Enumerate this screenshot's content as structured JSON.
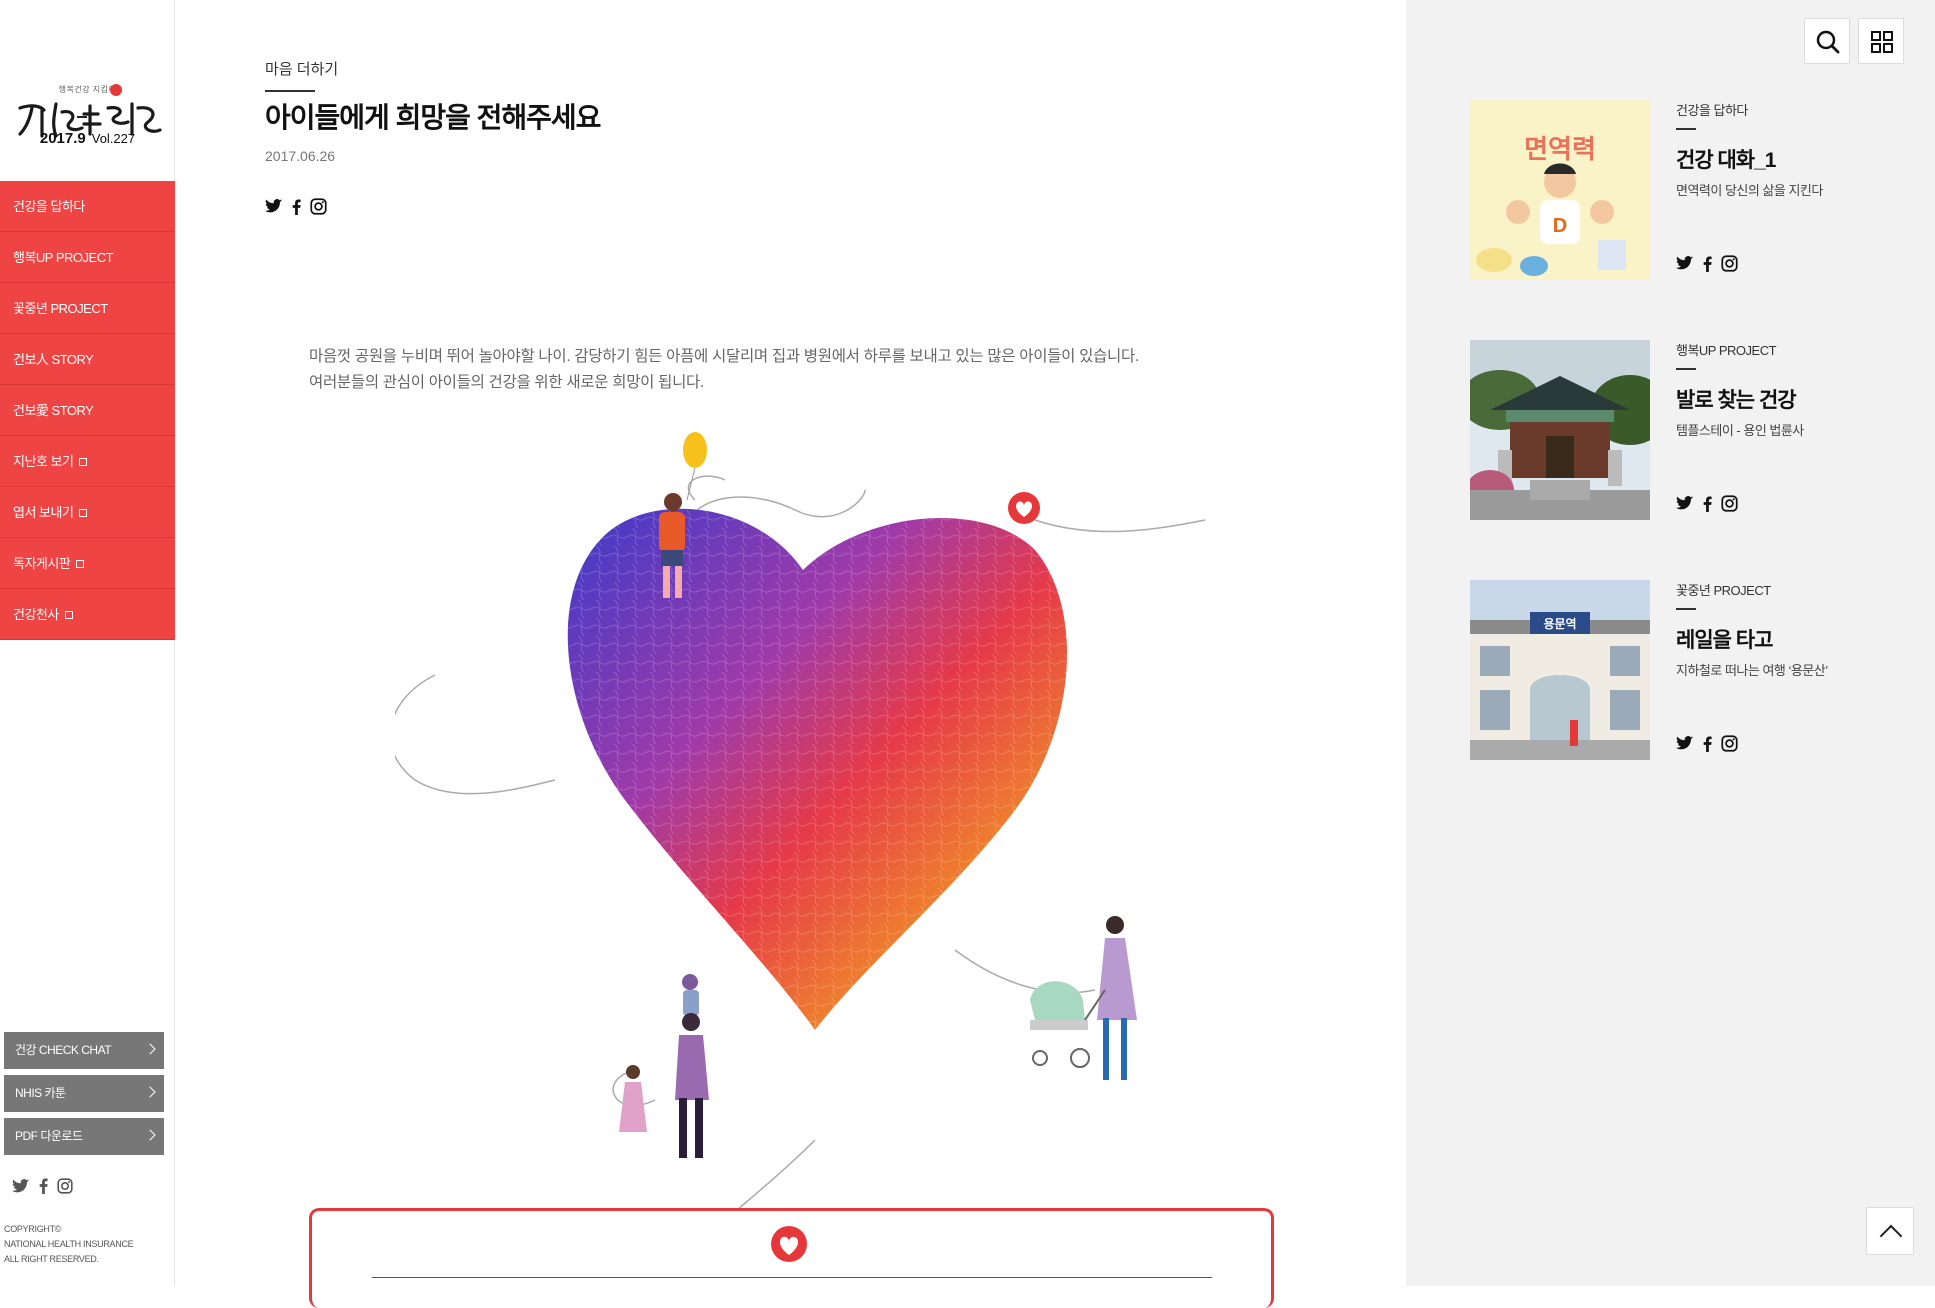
{
  "brand": {
    "tagline": "행복건강 지킴이",
    "logo_text": "건강보험",
    "issue_date": "2017.9",
    "issue_vol": "Vol.227"
  },
  "menu": [
    {
      "label": "건강을 답하다",
      "external": false
    },
    {
      "label": "행복UP PROJECT",
      "external": false
    },
    {
      "label": "꽃중년 PROJECT",
      "external": false
    },
    {
      "label": "건보人 STORY",
      "external": false
    },
    {
      "label": "건보愛 STORY",
      "external": false
    },
    {
      "label": "지난호 보기",
      "external": true
    },
    {
      "label": "엽서 보내기",
      "external": true
    },
    {
      "label": "독자게시판",
      "external": true
    },
    {
      "label": "건강천사",
      "external": true
    }
  ],
  "utility": [
    {
      "label": "건강 CHECK CHAT"
    },
    {
      "label": "NHIS 카툰"
    },
    {
      "label": "PDF 다운로드"
    }
  ],
  "copyright": [
    "COPYRIGHT©",
    "NATIONAL HEALTH INSURANCE",
    "ALL RIGHT RESERVED."
  ],
  "article": {
    "category": "마음 더하기",
    "title": "아이들에게 희망을 전해주세요",
    "date": "2017.06.26",
    "body": [
      "마음껏 공원을 누비며 뛰어 놀아야할 나이. 감당하기 힘든 아픔에 시달리며 집과 병원에서 하루를 보내고 있는 많은 아이들이 있습니다.",
      "여러분들의 관심이 아이들의 건강을 위한 새로운 희망이 됩니다."
    ]
  },
  "related": [
    {
      "category": "건강을 답하다",
      "title": "건강 대화_1",
      "subtitle": "면역력이 당신의 삶을 지킨다",
      "thumb_text": "면역력"
    },
    {
      "category": "행복UP PROJECT",
      "title": "발로 찾는 건강",
      "subtitle": "템플스테이 - 용인 법륜사",
      "thumb_text": ""
    },
    {
      "category": "꽃중년 PROJECT",
      "title": "레일을 타고",
      "subtitle": "지하철로 떠나는 여행 ‘용문산’",
      "thumb_text": "용문역"
    }
  ],
  "icons": {
    "twitter": "twitter-icon",
    "facebook": "facebook-icon",
    "instagram": "instagram-icon",
    "search": "search-icon",
    "grid": "grid-icon"
  },
  "colors": {
    "accent": "#ee4444",
    "util": "#777777",
    "panel": "#f2f2f2"
  }
}
